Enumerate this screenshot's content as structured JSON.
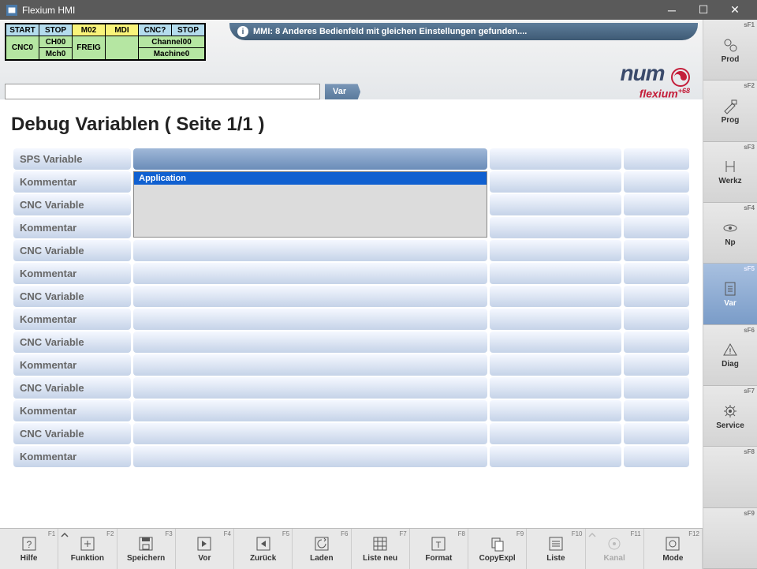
{
  "window": {
    "title": "Flexium HMI"
  },
  "status_grid": {
    "row1": [
      "START",
      "STOP",
      "M02",
      "MDI",
      "CNC?",
      "STOP"
    ],
    "row2": [
      "CNC0",
      "CH00",
      "FREIG",
      "",
      "Channel00",
      ""
    ],
    "row3": [
      "",
      "Mch0",
      "",
      "",
      "Machine0",
      ""
    ]
  },
  "message": "MMI: 8 Anderes Bedienfeld mit gleichen Einstellungen gefunden....",
  "brand": {
    "name": "num",
    "product": "flexium",
    "suffix": "+68"
  },
  "path_input": "",
  "breadcrumb_tag": "Var",
  "page_title": "Debug Variablen ( Seite 1/1 )",
  "labels": {
    "sps_var": "SPS Variable",
    "cnc_var": "CNC Variable",
    "kommentar": "Kommentar"
  },
  "dropdown_item": "Application",
  "side_keys": [
    {
      "num": "sF1",
      "label": "Prod",
      "icon": "gears"
    },
    {
      "num": "sF2",
      "label": "Prog",
      "icon": "hammer"
    },
    {
      "num": "sF3",
      "label": "Werkz",
      "icon": "caliper"
    },
    {
      "num": "sF4",
      "label": "Np",
      "icon": "orbit"
    },
    {
      "num": "sF5",
      "label": "Var",
      "icon": "doc",
      "active": true
    },
    {
      "num": "sF6",
      "label": "Diag",
      "icon": "warn"
    },
    {
      "num": "sF7",
      "label": "Service",
      "icon": "gear"
    },
    {
      "num": "sF8",
      "label": "",
      "icon": ""
    },
    {
      "num": "sF9",
      "label": "",
      "icon": ""
    }
  ],
  "foot_keys": [
    {
      "num": "F1",
      "label": "Hilfe",
      "icon": "help"
    },
    {
      "num": "F2",
      "label": "Funktion",
      "icon": "plus",
      "chev": true
    },
    {
      "num": "F3",
      "label": "Speichern",
      "icon": "save"
    },
    {
      "num": "F4",
      "label": "Vor",
      "icon": "fwd"
    },
    {
      "num": "F5",
      "label": "Zurück",
      "icon": "back"
    },
    {
      "num": "F6",
      "label": "Laden",
      "icon": "reload"
    },
    {
      "num": "F7",
      "label": "Liste neu",
      "icon": "grid"
    },
    {
      "num": "F8",
      "label": "Format",
      "icon": "format"
    },
    {
      "num": "F9",
      "label": "CopyExpl",
      "icon": "copy"
    },
    {
      "num": "F10",
      "label": "Liste",
      "icon": "list"
    },
    {
      "num": "F11",
      "label": "Kanal",
      "icon": "channel",
      "disabled": true,
      "chev": true
    },
    {
      "num": "F12",
      "label": "Mode",
      "icon": "mode"
    }
  ]
}
